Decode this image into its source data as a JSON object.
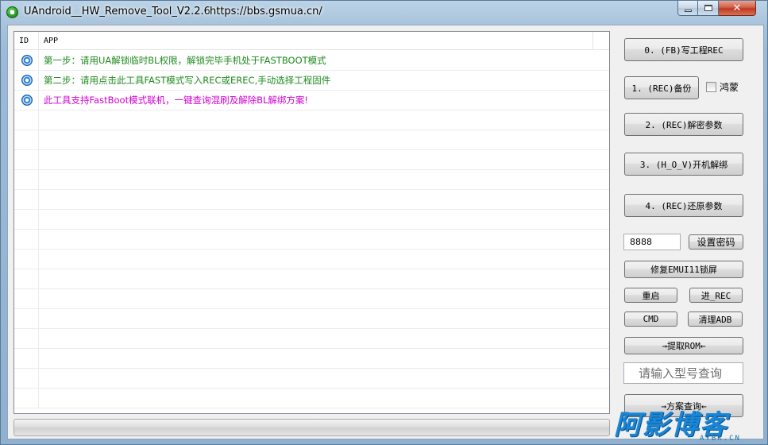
{
  "window": {
    "title": "UAndroid__HW_Remove_Tool_V2.2.6",
    "url": "https://bbs.gsmua.cn/",
    "caption": {
      "close_glyph": "✕"
    }
  },
  "list": {
    "columns": [
      "ID",
      "APP"
    ],
    "rows": [
      {
        "icon": "radio-target-icon",
        "text": "第一步：请用UA解锁临时BL权限，解锁完毕手机处于FASTBOOT模式",
        "color": "#1e8a1e"
      },
      {
        "icon": "radio-target-icon",
        "text": "第二步：请用点击此工具FAST模式写入REC或EREC,手动选择工程固件",
        "color": "#1e8a1e"
      },
      {
        "icon": "radio-target-icon",
        "text": "此工具支持FastBoot模式联机，一键查询混刷及解除BL解绑方案!",
        "color": "#d000d0"
      }
    ]
  },
  "panel": {
    "btn_fb_rec": "0. (FB)写工程REC",
    "btn_rec_backup": "1. (REC)备份",
    "chk_hongmeng": "鸿蒙",
    "btn_decrypt_params": "2. (REC)解密参数",
    "btn_boot_unbind": "3. (H_O_V)开机解绑",
    "btn_restore_params": "4. (REC)还原参数",
    "password_value": "8888",
    "btn_set_password": "设置密码",
    "btn_fix_emui11": "修复EMUI11锁屏",
    "btn_reboot": "重启",
    "btn_enter_rec": "进_REC",
    "btn_cmd": "CMD",
    "btn_clean_adb": "清理ADB",
    "btn_extract_rom": "→提取ROM←",
    "model_query_placeholder": "请输入型号查询",
    "btn_solution_query": "→方案查询←"
  },
  "watermark": {
    "text": "阿影博客",
    "sub": "AYBK.CN"
  }
}
